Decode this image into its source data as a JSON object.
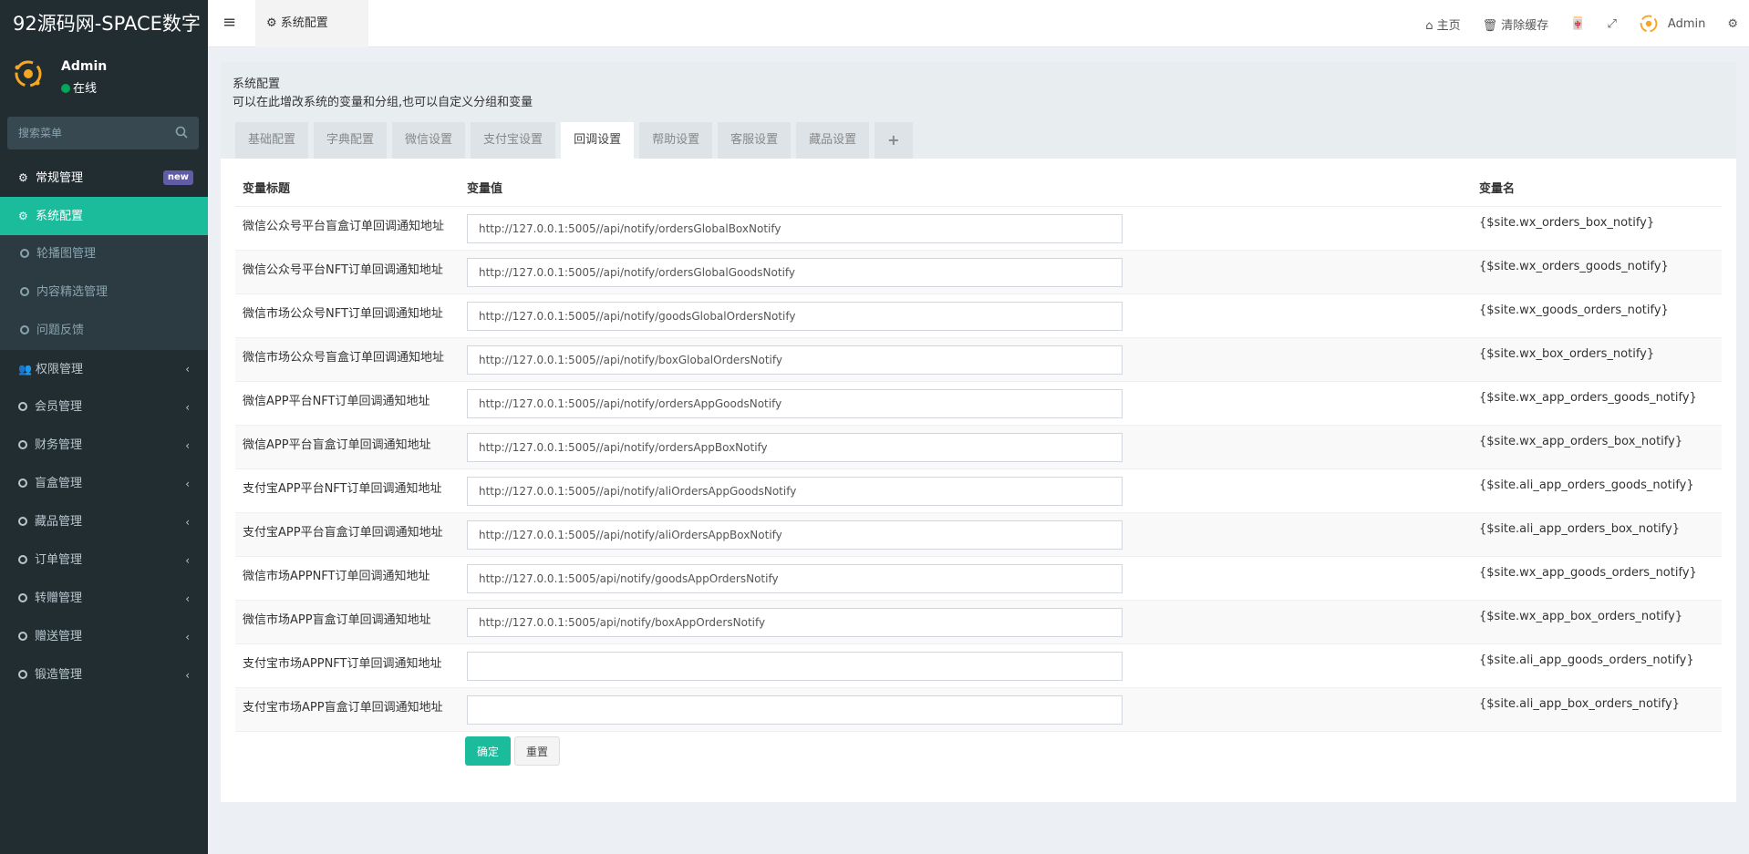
{
  "app": {
    "title": "92源码网-SPACE数字"
  },
  "user": {
    "name": "Admin",
    "status": "在线"
  },
  "sidebar": {
    "search_placeholder": "搜索菜单",
    "items": [
      {
        "label": "常规管理",
        "badge": "new"
      },
      {
        "label": "系统配置"
      },
      {
        "label": "轮播图管理"
      },
      {
        "label": "内容精选管理"
      },
      {
        "label": "问题反馈"
      },
      {
        "label": "权限管理"
      },
      {
        "label": "会员管理"
      },
      {
        "label": "财务管理"
      },
      {
        "label": "盲盒管理"
      },
      {
        "label": "藏品管理"
      },
      {
        "label": "订单管理"
      },
      {
        "label": "转赠管理"
      },
      {
        "label": "赠送管理"
      },
      {
        "label": "锻造管理"
      }
    ]
  },
  "header": {
    "tab_label": "系统配置",
    "home": "主页",
    "clear_cache": "清除缓存",
    "user": "Admin"
  },
  "panel": {
    "title": "系统配置",
    "description": "可以在此增改系统的变量和分组,也可以自定义分组和变量",
    "tabs": [
      "基础配置",
      "字典配置",
      "微信设置",
      "支付宝设置",
      "回调设置",
      "帮助设置",
      "客服设置",
      "藏品设置"
    ],
    "plus": "+"
  },
  "table": {
    "headers": {
      "title": "变量标题",
      "value": "变量值",
      "name": "变量名"
    },
    "rows": [
      {
        "title": "微信公众号平台盲盒订单回调通知地址",
        "value": "http://127.0.0.1:5005//api/notify/ordersGlobalBoxNotify",
        "name": "{$site.wx_orders_box_notify}"
      },
      {
        "title": "微信公众号平台NFT订单回调通知地址",
        "value": "http://127.0.0.1:5005//api/notify/ordersGlobalGoodsNotify",
        "name": "{$site.wx_orders_goods_notify}"
      },
      {
        "title": "微信市场公众号NFT订单回调通知地址",
        "value": "http://127.0.0.1:5005//api/notify/goodsGlobalOrdersNotify",
        "name": "{$site.wx_goods_orders_notify}"
      },
      {
        "title": "微信市场公众号盲盒订单回调通知地址",
        "value": "http://127.0.0.1:5005//api/notify/boxGlobalOrdersNotify",
        "name": "{$site.wx_box_orders_notify}"
      },
      {
        "title": "微信APP平台NFT订单回调通知地址",
        "value": "http://127.0.0.1:5005//api/notify/ordersAppGoodsNotify",
        "name": "{$site.wx_app_orders_goods_notify}"
      },
      {
        "title": "微信APP平台盲盒订单回调通知地址",
        "value": "http://127.0.0.1:5005//api/notify/ordersAppBoxNotify",
        "name": "{$site.wx_app_orders_box_notify}"
      },
      {
        "title": "支付宝APP平台NFT订单回调通知地址",
        "value": "http://127.0.0.1:5005//api/notify/aliOrdersAppGoodsNotify",
        "name": "{$site.ali_app_orders_goods_notify}"
      },
      {
        "title": "支付宝APP平台盲盒订单回调通知地址",
        "value": "http://127.0.0.1:5005//api/notify/aliOrdersAppBoxNotify",
        "name": "{$site.ali_app_orders_box_notify}"
      },
      {
        "title": "微信市场APPNFT订单回调通知地址",
        "value": "http://127.0.0.1:5005/api/notify/goodsAppOrdersNotify",
        "name": "{$site.wx_app_goods_orders_notify}"
      },
      {
        "title": "微信市场APP盲盒订单回调通知地址",
        "value": "http://127.0.0.1:5005/api/notify/boxAppOrdersNotify",
        "name": "{$site.wx_app_box_orders_notify}"
      },
      {
        "title": "支付宝市场APPNFT订单回调通知地址",
        "value": "",
        "name": "{$site.ali_app_goods_orders_notify}"
      },
      {
        "title": "支付宝市场APP盲盒订单回调通知地址",
        "value": "",
        "name": "{$site.ali_app_box_orders_notify}"
      }
    ]
  },
  "buttons": {
    "confirm": "确定",
    "reset": "重置"
  },
  "colors": {
    "accent": "#1abc9c",
    "sidebar_bg": "#222d32",
    "badge": "#605ca8"
  }
}
